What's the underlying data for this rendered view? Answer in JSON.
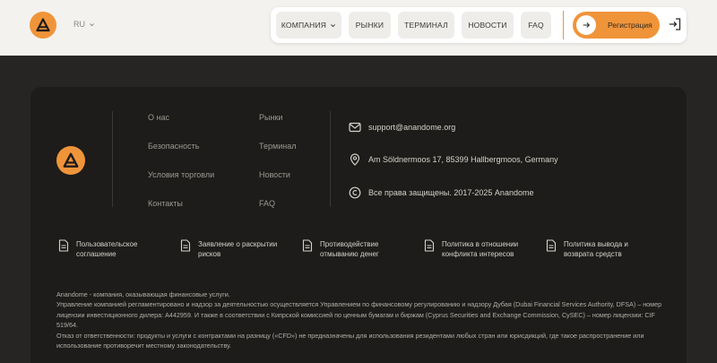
{
  "colors": {
    "accent": "#f0943a",
    "header_bg": "#f4f2ee",
    "page_bg": "#262523",
    "card_bg": "#1d1c1a"
  },
  "header": {
    "logo_icon": "triangle-logo-icon",
    "language": "RU",
    "nav": [
      {
        "label": "КОМПАНИЯ",
        "has_dropdown": true
      },
      {
        "label": "РЫНКИ"
      },
      {
        "label": "ТЕРМИНАЛ"
      },
      {
        "label": "НОВОСТИ"
      },
      {
        "label": "FAQ"
      }
    ],
    "register_label": "Регистрация",
    "login_icon": "login-icon"
  },
  "footer": {
    "links_col1": [
      "О нас",
      "Безопасность",
      "Условия торговли",
      "Контакты"
    ],
    "links_col2": [
      "Рынки",
      "Терминал",
      "Новости",
      "FAQ"
    ],
    "contacts": {
      "email": "support@anandome.org",
      "address": "Am Söldnermoos 17, 85399 Hallbergmoos, Germany",
      "copyright": "Все права защищены. 2017-2025 Anandome"
    },
    "documents": [
      "Пользовательское соглашение",
      "Заявление о раскрытии рисков",
      "Противодействие отмыванию денег",
      "Политика в отношении конфликта интересов",
      "Политика вывода и возврата средств"
    ],
    "disclaimer": [
      "Anandome - компания, оказывающая финансовые услуги.",
      "Управление компанией регламентировано и надзор за деятельностью осуществляется Управлением по финансовому регулированию и надзору Дубая (Dubai Financial Services Authority, DFSA) – номер лицензии инвестиционного дилера: A442959. И также в соответствии с Кипрской комиссией по ценным бумагам и биржам (Cyprus Securities and Exchange Commission, CySEC) – номер лицензии: CIF 519/64.",
      "Отказ от ответственности: продукты и услуги с контрактами на разницу («CFD») не предназначены для использования резидентами любых стран или юрисдикций, где такое распространение или использование противоречит местному законодательству."
    ]
  }
}
